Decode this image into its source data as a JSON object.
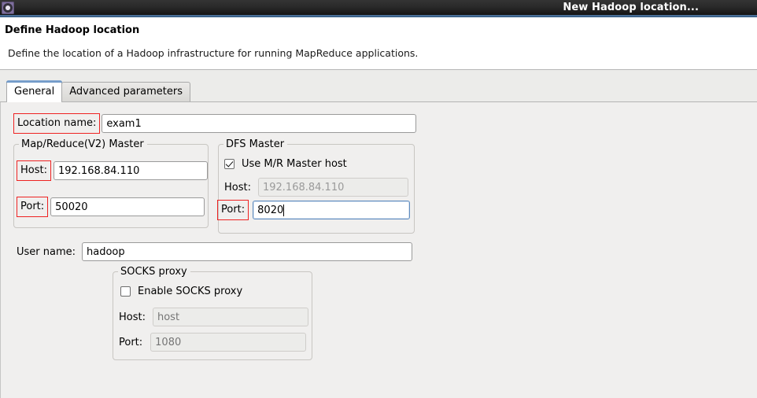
{
  "window": {
    "title": "New Hadoop location...",
    "icon": "gear-icon"
  },
  "header": {
    "title": "Define Hadoop location",
    "description": "Define the location of a Hadoop infrastructure for running MapReduce applications."
  },
  "tabs": [
    {
      "label": "General",
      "active": true
    },
    {
      "label": "Advanced parameters",
      "active": false
    }
  ],
  "form": {
    "location_name": {
      "label": "Location name:",
      "value": "exam1",
      "highlighted": true
    },
    "mapreduce_master": {
      "legend": "Map/Reduce(V2) Master",
      "host": {
        "label": "Host:",
        "value": "192.168.84.110",
        "highlighted": true
      },
      "port": {
        "label": "Port:",
        "value": "50020",
        "highlighted": true
      }
    },
    "dfs_master": {
      "legend": "DFS Master",
      "use_mr_master_host": {
        "label": "Use M/R Master host",
        "checked": true
      },
      "host": {
        "label": "Host:",
        "value": "192.168.84.110",
        "disabled": true
      },
      "port": {
        "label": "Port:",
        "value": "8020",
        "highlighted": true,
        "focused": true
      }
    },
    "user_name": {
      "label": "User name:",
      "value": "hadoop"
    },
    "socks_proxy": {
      "legend": "SOCKS proxy",
      "enable": {
        "label": "Enable SOCKS proxy",
        "checked": false
      },
      "host": {
        "label": "Host:",
        "placeholder": "host",
        "disabled": true
      },
      "port": {
        "label": "Port:",
        "placeholder": "1080",
        "disabled": true
      }
    }
  },
  "colors": {
    "highlight_box": "#ee2222",
    "focus_border": "#5f8cc0",
    "titlebar_accent": "#55789f"
  }
}
